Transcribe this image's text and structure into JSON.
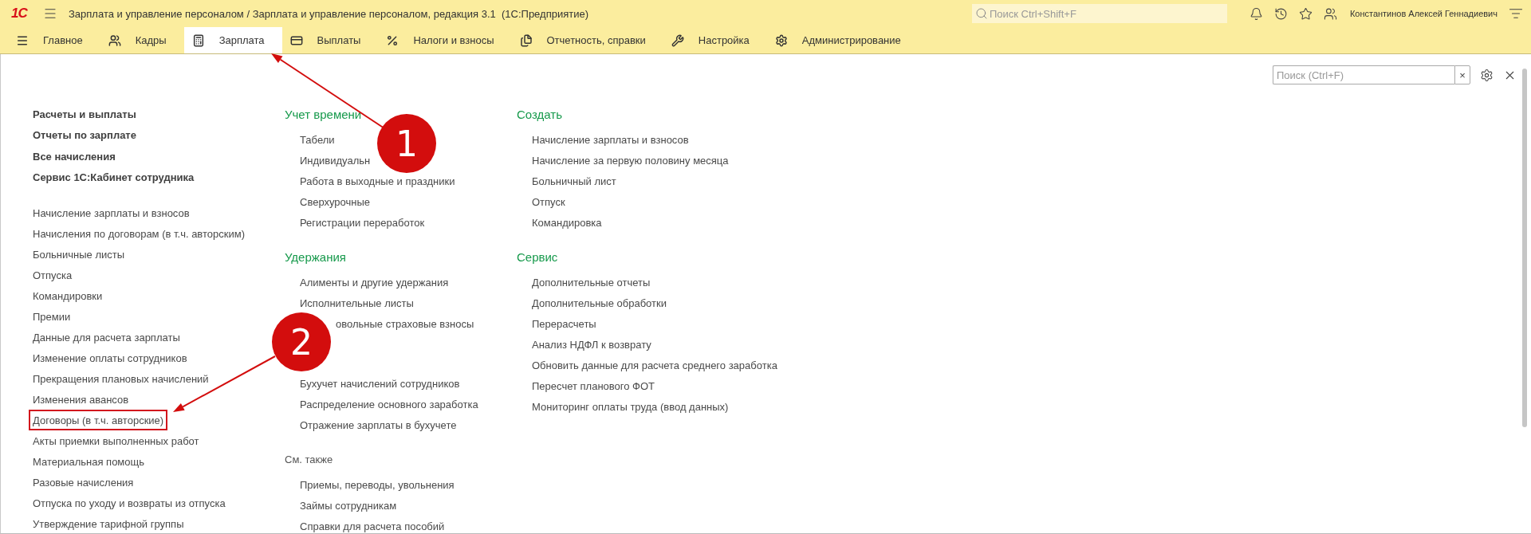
{
  "app": {
    "logo": "1С",
    "title": "Зарплата и управление персоналом / Зарплата и управление персоналом, редакция 3.1  (1С:Предприятие)",
    "search": {
      "placeholder": "Поиск Ctrl+Shift+F"
    },
    "user": "Константинов Алексей Геннадиевич"
  },
  "sections": [
    {
      "label": "Главное",
      "selected": false
    },
    {
      "label": "Кадры",
      "selected": false
    },
    {
      "label": "Зарплата",
      "selected": true
    },
    {
      "label": "Выплаты",
      "selected": false
    },
    {
      "label": "Налоги и взносы",
      "selected": false
    },
    {
      "label": "Отчетность, справки",
      "selected": false
    },
    {
      "label": "Настройка",
      "selected": false
    },
    {
      "label": "Администрирование",
      "selected": false
    }
  ],
  "panel": {
    "search": {
      "placeholder": "Поиск (Ctrl+F)"
    },
    "clear": "×"
  },
  "main_links": [
    {
      "label": "Расчеты и выплаты",
      "bold": true,
      "highlighted": false
    },
    {
      "label": "Отчеты по зарплате",
      "bold": true,
      "highlighted": false
    },
    {
      "label": "Все начисления",
      "bold": true,
      "highlighted": false
    },
    {
      "label": "Сервис 1С:Кабинет сотрудника",
      "bold": true,
      "highlighted": false
    },
    {
      "label": "Начисление зарплаты и взносов",
      "bold": false,
      "highlighted": false
    },
    {
      "label": "Начисления по договорам (в т.ч. авторским)",
      "bold": false,
      "highlighted": false
    },
    {
      "label": "Больничные листы",
      "bold": false,
      "highlighted": false
    },
    {
      "label": "Отпуска",
      "bold": false,
      "highlighted": false
    },
    {
      "label": "Командировки",
      "bold": false,
      "highlighted": false
    },
    {
      "label": "Премии",
      "bold": false,
      "highlighted": false
    },
    {
      "label": "Данные для расчета зарплаты",
      "bold": false,
      "highlighted": false
    },
    {
      "label": "Изменение оплаты сотрудников",
      "bold": false,
      "highlighted": false
    },
    {
      "label": "Прекращения плановых начислений",
      "bold": false,
      "highlighted": false
    },
    {
      "label": "Изменения авансов",
      "bold": false,
      "highlighted": false
    },
    {
      "label": "Договоры (в т.ч. авторские)",
      "bold": false,
      "highlighted": true
    },
    {
      "label": "Акты приемки выполненных работ",
      "bold": false,
      "highlighted": false
    },
    {
      "label": "Материальная помощь",
      "bold": false,
      "highlighted": false
    },
    {
      "label": "Разовые начисления",
      "bold": false,
      "highlighted": false
    },
    {
      "label": "Отпуска по уходу и возвраты из отпуска",
      "bold": false,
      "highlighted": false
    },
    {
      "label": "Утверждение тарифной группы",
      "bold": false,
      "highlighted": false
    }
  ],
  "middle_groups": [
    {
      "kind": "group",
      "title": "Учет времени",
      "items": [
        {
          "label": "Табели",
          "kind": "link"
        },
        {
          "label": "Индивидуальн",
          "kind": "link"
        },
        {
          "label": "Работа в выходные и праздники",
          "kind": "link"
        },
        {
          "label": "Сверхурочные",
          "kind": "link"
        },
        {
          "label": "Регистрации переработок",
          "kind": "link"
        }
      ]
    },
    {
      "kind": "group",
      "title": "Удержания",
      "items": [
        {
          "label": "Алименты и другие удержания",
          "kind": "link"
        },
        {
          "label": "Исполнительные листы",
          "kind": "link"
        },
        {
          "label": "овольные страховые взносы",
          "kind": "covered"
        }
      ]
    },
    {
      "kind": "hidden",
      "items": [
        {
          "label": "Бухучет начислений сотрудников",
          "kind": "link"
        },
        {
          "label": "Распределение основного заработка",
          "kind": "link"
        },
        {
          "label": "Отражение зарплаты в бухучете",
          "kind": "link"
        }
      ]
    },
    {
      "kind": "see_also",
      "title": "См. также",
      "items": [
        {
          "label": "Приемы, переводы, увольнения",
          "kind": "link"
        },
        {
          "label": "Займы сотрудникам",
          "kind": "link"
        },
        {
          "label": "Справки для расчета пособий",
          "kind": "link"
        }
      ]
    }
  ],
  "right_groups": [
    {
      "kind": "group",
      "title": "Создать",
      "items": [
        {
          "label": "Начисление зарплаты и взносов",
          "kind": "link"
        },
        {
          "label": "Начисление за первую половину месяца",
          "kind": "link"
        },
        {
          "label": "Больничный лист",
          "kind": "link"
        },
        {
          "label": "Отпуск",
          "kind": "link"
        },
        {
          "label": "Командировка",
          "kind": "link"
        }
      ]
    },
    {
      "kind": "group",
      "title": "Сервис",
      "items": [
        {
          "label": "Дополнительные отчеты",
          "kind": "link"
        },
        {
          "label": "Дополнительные обработки",
          "kind": "link"
        },
        {
          "label": "Перерасчеты",
          "kind": "link"
        },
        {
          "label": "Анализ НДФЛ к возврату",
          "kind": "link"
        },
        {
          "label": "Обновить данные для расчета среднего заработка",
          "kind": "link"
        },
        {
          "label": "Пересчет планового ФОТ",
          "kind": "link"
        },
        {
          "label": "Мониторинг оплаты труда (ввод данных)",
          "kind": "link"
        }
      ]
    }
  ],
  "annotations": [
    {
      "label": "1"
    },
    {
      "label": "2"
    }
  ]
}
